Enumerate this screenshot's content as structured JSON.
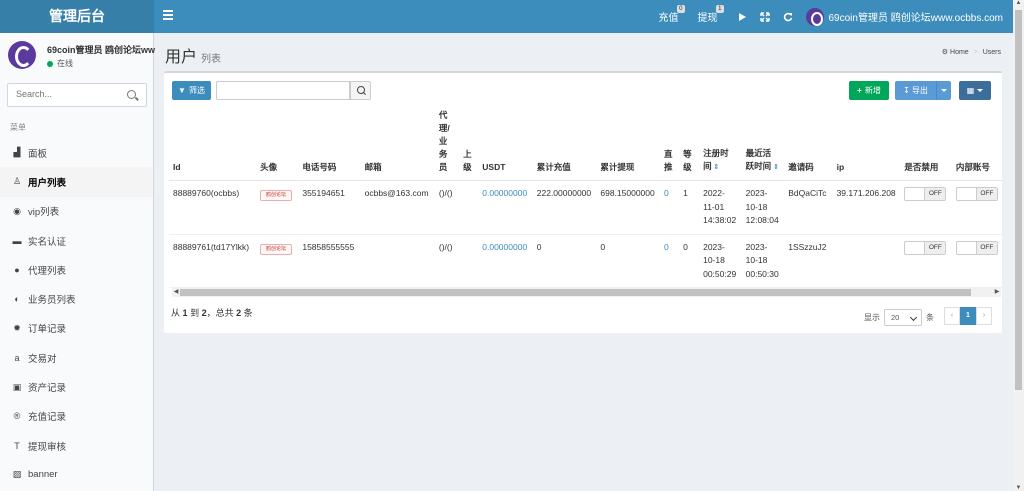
{
  "header": {
    "brand": "管理后台",
    "recharge_label": "充值",
    "recharge_badge": "0",
    "withdraw_label": "提现",
    "withdraw_badge": "1",
    "site_name": "69coin管理员 鸥创论坛www.ocbbs.com"
  },
  "sidebar": {
    "user_name": "69coin管理员 鸥创论坛ww",
    "status": "在线",
    "search_placeholder": "Search...",
    "menu_header": "菜单",
    "items": [
      {
        "label": "面板",
        "icon": "dashboard-icon",
        "glyph": "▟"
      },
      {
        "label": "用户列表",
        "icon": "user-icon",
        "glyph": "♙"
      },
      {
        "label": "vip列表",
        "icon": "vip-icon",
        "glyph": "◉"
      },
      {
        "label": "实名认证",
        "icon": "id-card-icon",
        "glyph": "▬"
      },
      {
        "label": "代理列表",
        "icon": "agent-icon",
        "glyph": "●"
      },
      {
        "label": "业务员列表",
        "icon": "salesman-icon",
        "glyph": "◐"
      },
      {
        "label": "订单记录",
        "icon": "gear-icon",
        "glyph": "✹"
      },
      {
        "label": "交易对",
        "icon": "amazon-icon",
        "glyph": "a"
      },
      {
        "label": "资产记录",
        "icon": "asset-icon",
        "glyph": "▣"
      },
      {
        "label": "充值记录",
        "icon": "registered-icon",
        "glyph": "®"
      },
      {
        "label": "提现审核",
        "icon": "text-icon",
        "glyph": "T"
      },
      {
        "label": "banner",
        "icon": "image-icon",
        "glyph": "▨"
      }
    ],
    "active_index": 1
  },
  "page": {
    "title": "用户",
    "subtitle": "列表",
    "breadcrumb_home": "Home",
    "breadcrumb_current": "Users"
  },
  "toolbar": {
    "filter_label": "筛选",
    "add_label": "新增",
    "export_label": "导出"
  },
  "table": {
    "columns": [
      {
        "label": "Id",
        "width": 88
      },
      {
        "label": "头像",
        "width": 43
      },
      {
        "label": "电话号码",
        "width": 63
      },
      {
        "label": "邮箱",
        "width": 75
      },
      {
        "label": "代\n理/\n业\n务\n员",
        "width": 25
      },
      {
        "label": "上\n级",
        "width": 20
      },
      {
        "label": "USDT",
        "width": 55
      },
      {
        "label": "累计充值",
        "width": 64
      },
      {
        "label": "累计提现",
        "width": 64
      },
      {
        "label": "直\n推",
        "width": 20
      },
      {
        "label": "等\n级",
        "width": 21
      },
      {
        "label": "注册时\n间",
        "width": 43,
        "sortable": true
      },
      {
        "label": "最近活\n跃时间",
        "width": 43,
        "sortable": true
      },
      {
        "label": "邀请码",
        "width": 49
      },
      {
        "label": "ip",
        "width": 68
      },
      {
        "label": "是否禁用",
        "width": 52
      },
      {
        "label": "内部账号",
        "width": 46
      }
    ],
    "rows": [
      {
        "id": "88889760(ocbbs)",
        "avatar": "鸥创论坛",
        "phone": "355194651",
        "email": "ocbbs@163.com",
        "agent": "()/()",
        "parent": "",
        "usdt": "0.00000000",
        "total_recharge": "222.00000000",
        "total_withdraw": "698.15000000",
        "direct": "0",
        "level": "1",
        "reg_time": "2022-\n11-01\n14:38:02",
        "active_time": "2023-\n10-18\n12:08:04",
        "invite": "BdQaCiTc",
        "ip": "39.171.206.208",
        "disabled": "OFF",
        "internal": "OFF"
      },
      {
        "id": "88889761(td17Ylkk)",
        "avatar": "鸥创论坛",
        "phone": "15858555555",
        "email": "",
        "agent": "()/()",
        "parent": "",
        "usdt": "0.00000000",
        "total_recharge": "0",
        "total_withdraw": "0",
        "direct": "0",
        "level": "0",
        "reg_time": "2023-\n10-18\n00:50:29",
        "active_time": "2023-\n10-18\n00:50:30",
        "invite": "1SSzzuJ2",
        "ip": "",
        "disabled": "OFF",
        "internal": "OFF"
      }
    ]
  },
  "footer": {
    "summary_prefix": "从",
    "from": "1",
    "summary_to": "到",
    "to": "2",
    "summary_total": "，总共",
    "total": "2",
    "summary_suffix": "条",
    "show_label": "显示",
    "page_size": "20",
    "per_label": "条",
    "prev": "‹",
    "current_page": "1",
    "next": "›"
  }
}
